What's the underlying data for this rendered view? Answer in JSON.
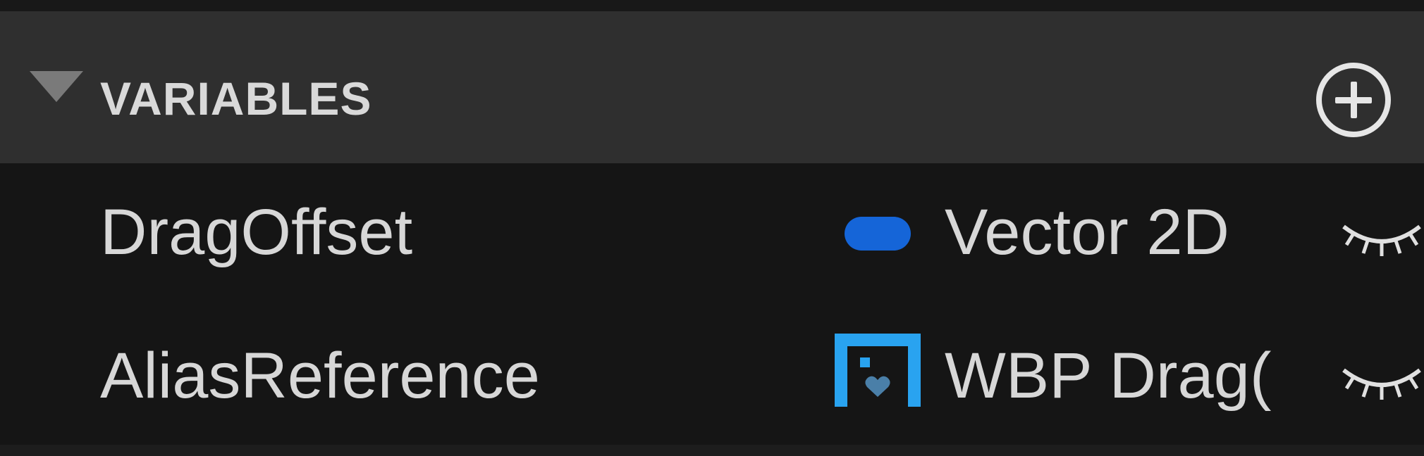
{
  "section": {
    "title": "VARIABLES",
    "collapse_icon": "triangle-down-icon",
    "add_icon": "plus-circle-icon"
  },
  "variables": [
    {
      "name": "DragOffset",
      "type_label": "Vector 2D",
      "type_icon": "vector2d-pill-icon",
      "type_color": "#1565d8",
      "visibility_icon": "eye-closed-icon"
    },
    {
      "name": "AliasReference",
      "type_label": "WBP Drag(",
      "type_icon": "widget-blueprint-icon",
      "type_color": "#29a3f0",
      "visibility_icon": "eye-closed-icon"
    }
  ],
  "colors": {
    "header_bg": "#2f2f2f",
    "list_bg": "#151515",
    "text": "#d7d7d7"
  }
}
